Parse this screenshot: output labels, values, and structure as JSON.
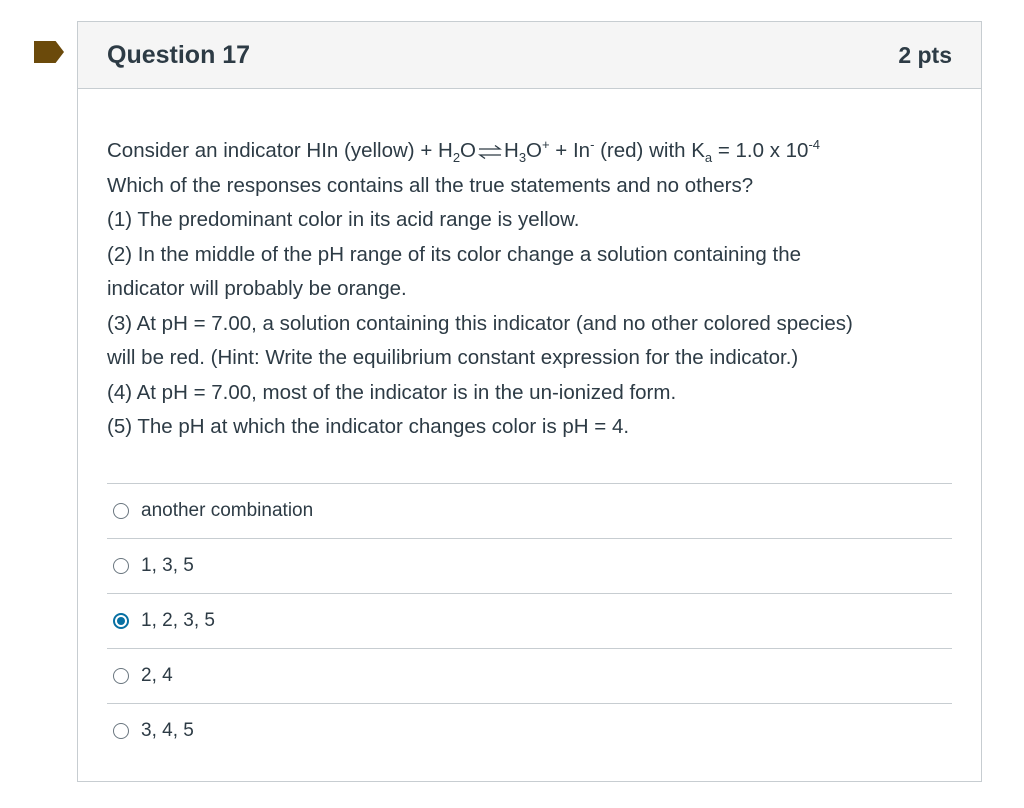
{
  "question": {
    "title": "Question 17",
    "points": "2 pts",
    "flag_color": "#6b4a0b",
    "equation": {
      "part1": "Consider an indicator HIn (yellow) + H",
      "sub1": "2",
      "part2": "O",
      "part3": "H",
      "sub2": "3",
      "part4": "O",
      "sup1": "+",
      "part5": " + In",
      "sup2": "-",
      "part6": " (red) with K",
      "sub3": "a",
      "part7": " = 1.0 x 10",
      "sup3": "-4"
    },
    "lines": [
      "Which of the responses contains all the true statements and no others?",
      "(1) The predominant color in its acid range is yellow.",
      "(2) In the middle of the pH range of its color change a solution containing the",
      "indicator will probably be orange.",
      "(3) At pH = 7.00, a solution containing this indicator (and no other colored species)",
      "will be red. (Hint: Write the equilibrium constant expression for the indicator.)",
      "(4) At pH = 7.00, most of the indicator is in the un-ionized form.",
      "(5) The pH at which the indicator changes color is pH = 4."
    ],
    "answers": [
      {
        "label": "another combination",
        "selected": false
      },
      {
        "label": "1, 3, 5",
        "selected": false
      },
      {
        "label": "1, 2, 3, 5",
        "selected": true
      },
      {
        "label": "2, 4",
        "selected": false
      },
      {
        "label": "3, 4, 5",
        "selected": false
      }
    ],
    "selected_color": "#0770a3"
  }
}
